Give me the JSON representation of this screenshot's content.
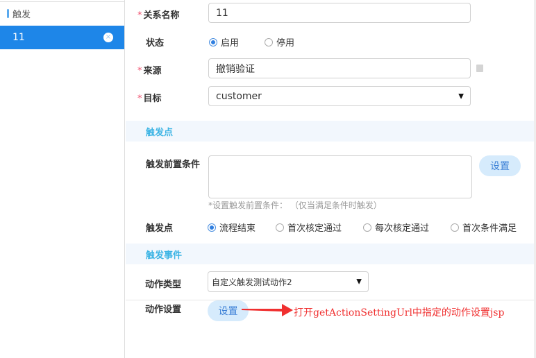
{
  "sidebar": {
    "header": "触发",
    "items": [
      {
        "label": "11",
        "close_icon": "×"
      }
    ]
  },
  "form": {
    "name": {
      "label": "关系名称",
      "value": "11"
    },
    "status": {
      "label": "状态",
      "options": [
        "启用",
        "停用"
      ],
      "selected": "启用"
    },
    "source": {
      "label": "来源",
      "value": "撤销验证"
    },
    "target": {
      "label": "目标",
      "value": "customer"
    }
  },
  "trigger_section": {
    "title": "触发点",
    "precondition_label": "触发前置条件",
    "precondition_value": "",
    "set_button": "设置",
    "hint": "*设置触发前置条件： （仅当满足条件时触发）",
    "point_label": "触发点",
    "point_options": [
      "流程结束",
      "首次核定通过",
      "每次核定通过",
      "首次条件满足"
    ],
    "point_selected": "流程结束"
  },
  "event_section": {
    "title": "触发事件",
    "action_type_label": "动作类型",
    "action_type_value": "自定义触发测试动作2",
    "action_setting_label": "动作设置",
    "set_button": "设置"
  },
  "annotation": {
    "text": "打开getActionSettingUrl中指定的动作设置jsp",
    "color": "#f03030"
  },
  "colors": {
    "accent": "#1e86e8",
    "section_title": "#3cb4e4"
  }
}
